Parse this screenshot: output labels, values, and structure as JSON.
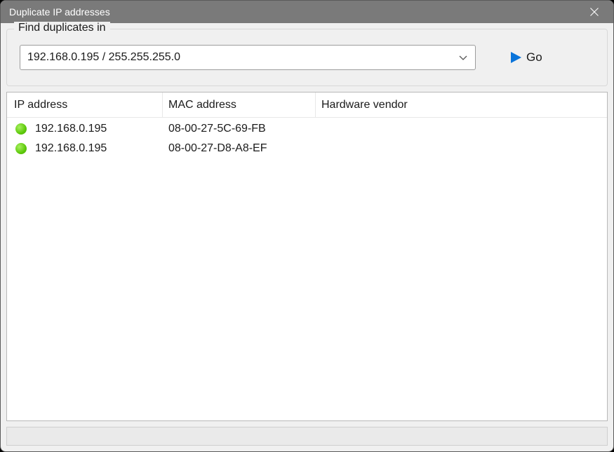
{
  "window": {
    "title": "Duplicate IP addresses"
  },
  "finder": {
    "legend": "Find duplicates in",
    "selected_network": "192.168.0.195 / 255.255.255.0",
    "go_label": "Go"
  },
  "columns": {
    "ip": "IP address",
    "mac": "MAC address",
    "vendor": "Hardware vendor"
  },
  "rows": [
    {
      "status": "online",
      "ip": "192.168.0.195",
      "mac": "08-00-27-5C-69-FB",
      "vendor": ""
    },
    {
      "status": "online",
      "ip": "192.168.0.195",
      "mac": "08-00-27-D8-A8-EF",
      "vendor": ""
    }
  ]
}
